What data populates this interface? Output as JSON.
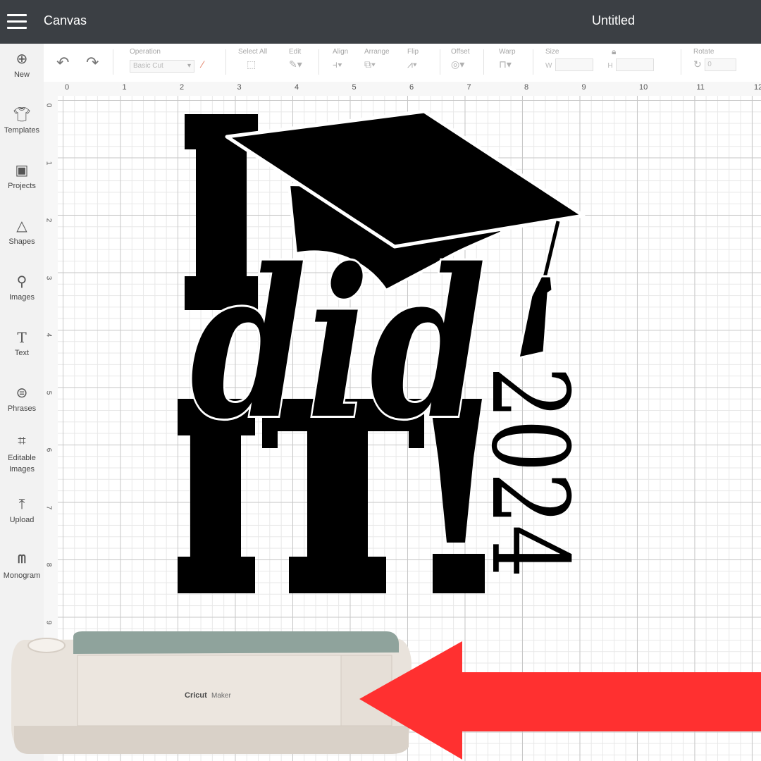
{
  "topbar": {
    "app_title": "Canvas",
    "doc_title": "Untitled"
  },
  "sidebar": {
    "items": [
      {
        "label": "New",
        "icon": "plus-circle-icon"
      },
      {
        "label": "Templates",
        "icon": "shirt-icon"
      },
      {
        "label": "Projects",
        "icon": "clipboard-icon"
      },
      {
        "label": "Shapes",
        "icon": "shapes-icon"
      },
      {
        "label": "Images",
        "icon": "lightbulb-icon"
      },
      {
        "label": "Text",
        "icon": "text-icon"
      },
      {
        "label": "Phrases",
        "icon": "speech-bubble-icon"
      },
      {
        "label": "Editable Images",
        "icon": "edit-image-icon"
      },
      {
        "label": "Upload",
        "icon": "upload-icon"
      },
      {
        "label": "Monogram",
        "icon": "monogram-icon"
      }
    ]
  },
  "toolbar": {
    "operation_label": "Operation",
    "operation_value": "Basic Cut",
    "select_all_label": "Select All",
    "edit_label": "Edit",
    "align_label": "Align",
    "arrange_label": "Arrange",
    "flip_label": "Flip",
    "offset_label": "Offset",
    "warp_label": "Warp",
    "size_label": "Size",
    "size_w_label": "W",
    "size_h_label": "H",
    "rotate_label": "Rotate",
    "rotate_value": "0"
  },
  "ruler": {
    "top": [
      "0",
      "1",
      "2",
      "3",
      "4",
      "5",
      "6",
      "7",
      "8",
      "9",
      "10",
      "11",
      "12"
    ],
    "left": [
      "0",
      "1",
      "2",
      "3",
      "4",
      "5",
      "6",
      "7",
      "8",
      "9"
    ]
  },
  "design": {
    "word_i": "I",
    "word_did": "did",
    "word_it": "IT!",
    "year": "2024"
  },
  "machine": {
    "brand": "Cricut",
    "model": "Maker"
  },
  "colors": {
    "topbar": "#3b3f44",
    "arrow": "#ff3030",
    "machine_lid": "#8fa39c",
    "machine_body": "#e9e3dc"
  }
}
